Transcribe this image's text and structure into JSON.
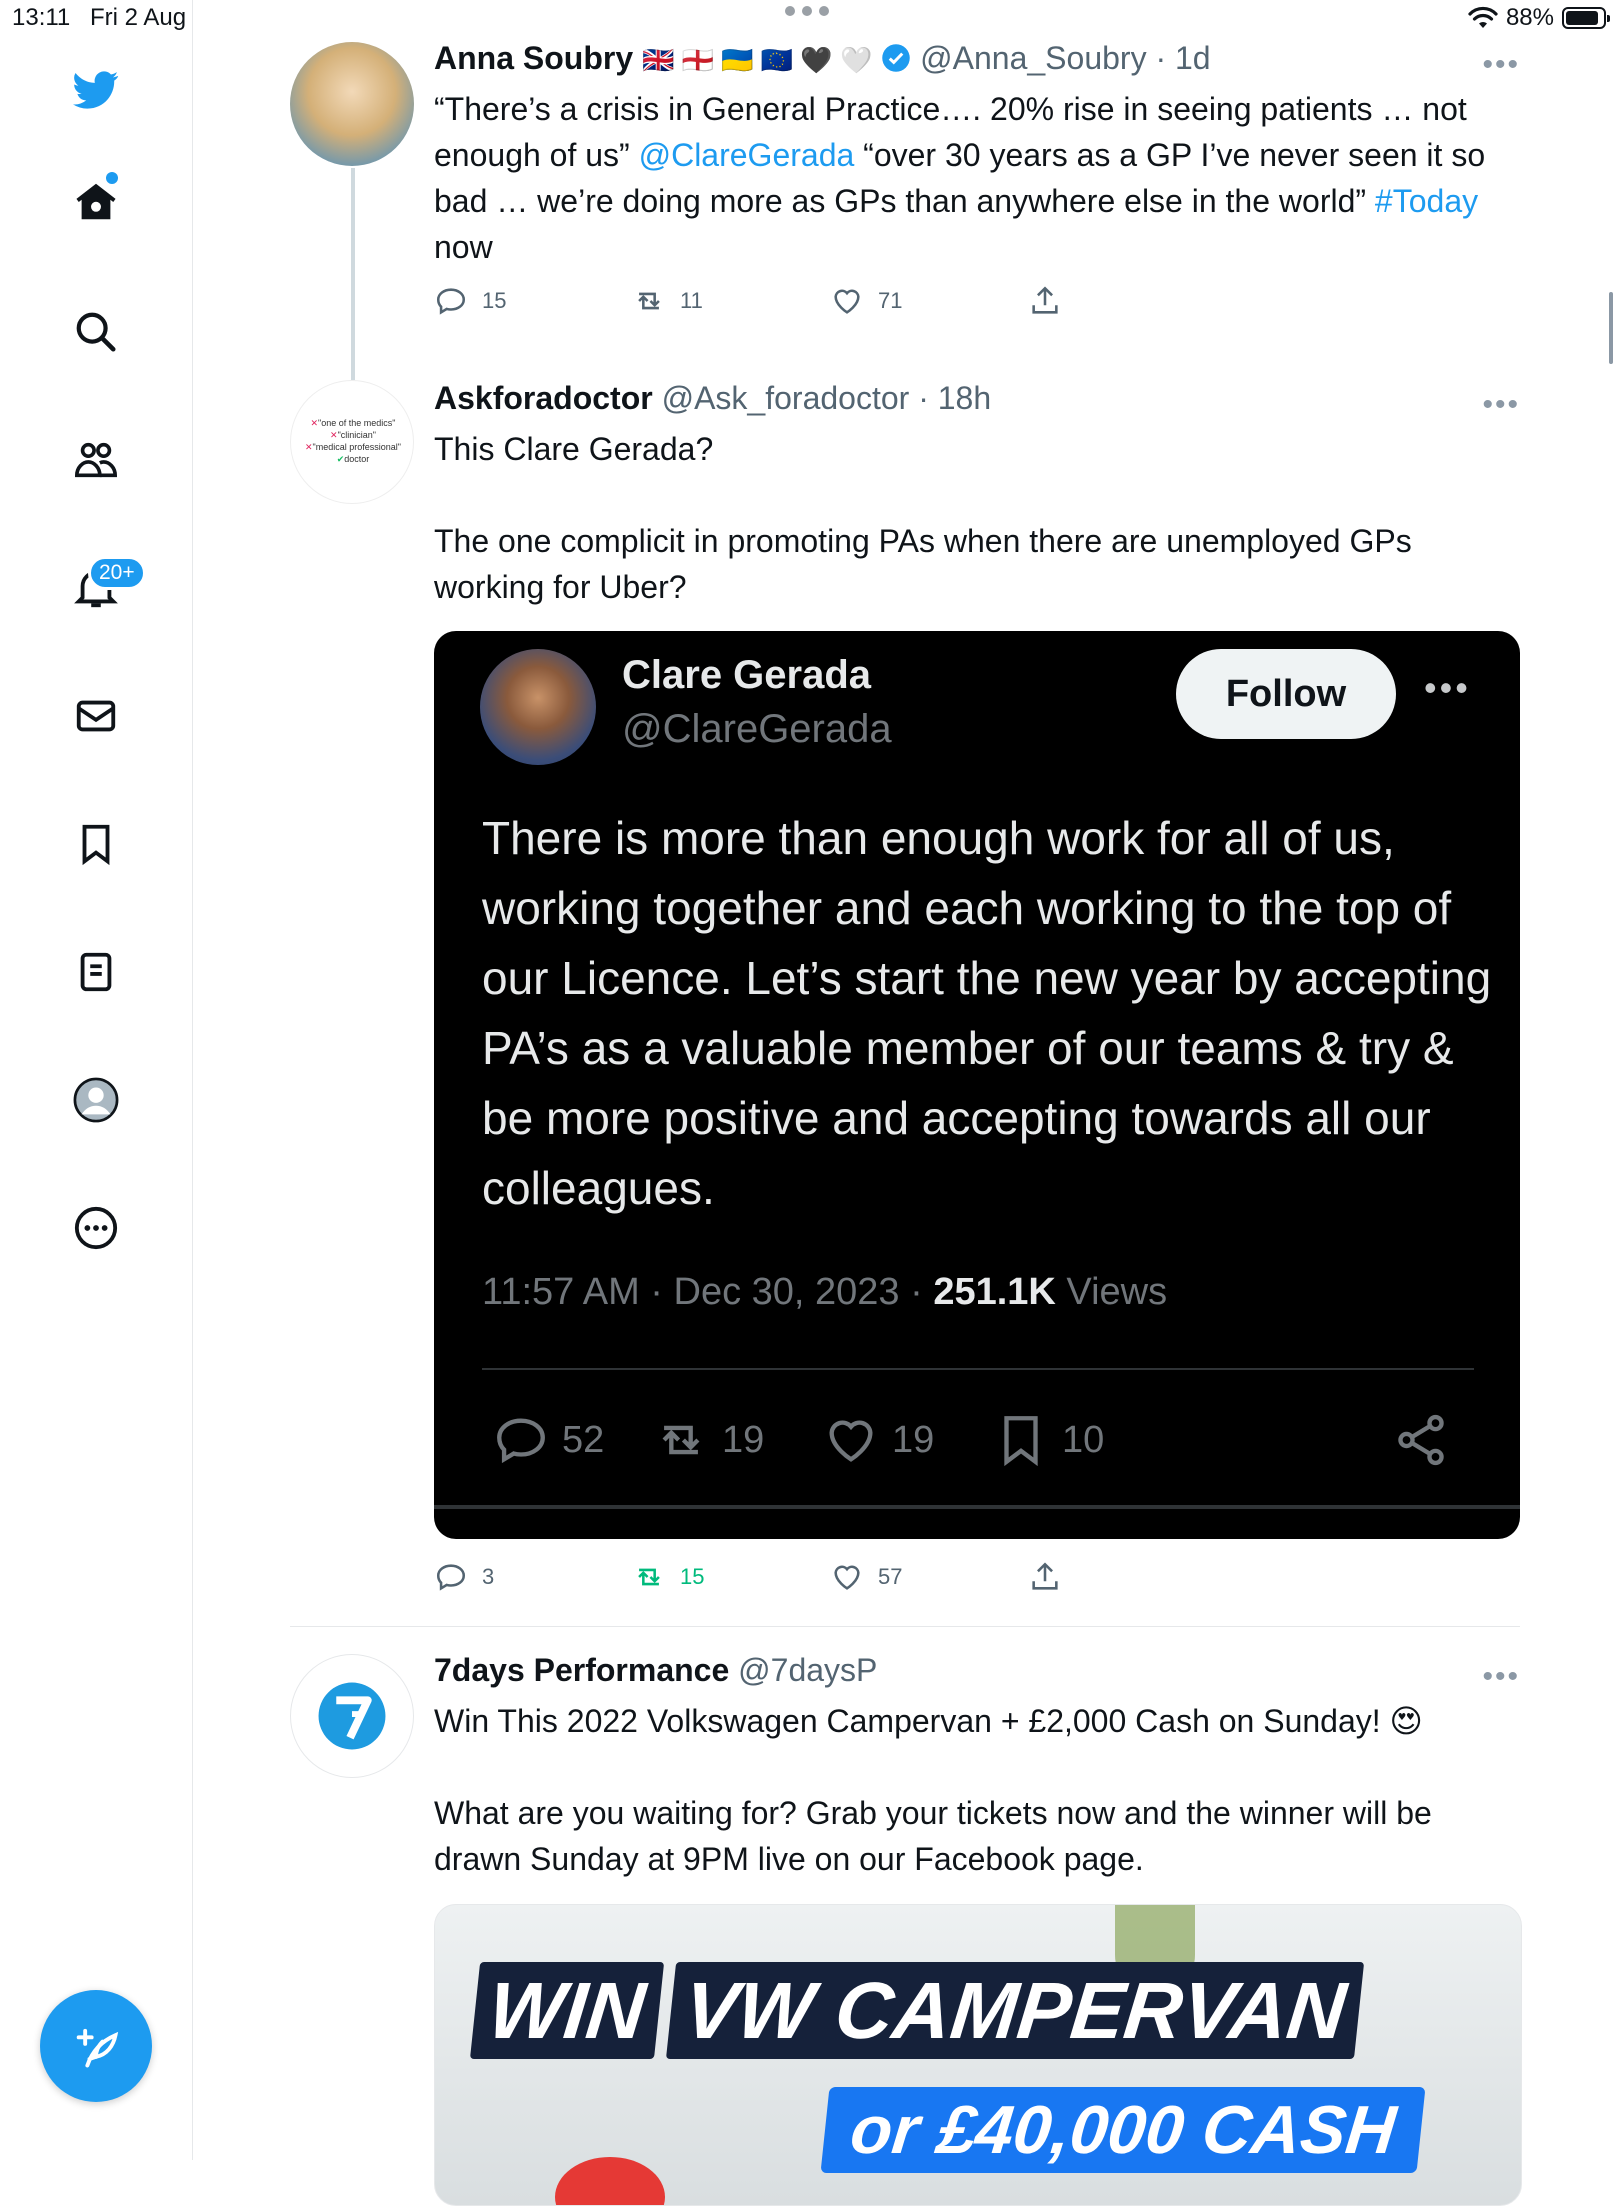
{
  "status_bar": {
    "time": "13:11",
    "date": "Fri 2 Aug",
    "battery": "88%",
    "battery_level": 0.88
  },
  "sidebar": {
    "notifications_badge": "20+",
    "items": [
      "home",
      "explore",
      "communities",
      "notifications",
      "messages",
      "bookmarks",
      "lists",
      "profile",
      "more"
    ]
  },
  "tweets": [
    {
      "name": "Anna Soubry",
      "flags": "🇬🇧 🏴󠁧󠁢󠁥󠁮󠁧󠁿 🇺🇦 🇪🇺 🖤 🤍",
      "handle": "@Anna_Soubry",
      "time": "· 1d",
      "text_1": "“There’s a crisis in General Practice…. 20% rise in seeing patients … not enough of us” ",
      "mention": "@ClareGerada",
      "text_2": " “over 30 years as a GP I’ve never seen it so bad … we’re doing more as GPs than anywhere else in the world” ",
      "hashtag": "#Today",
      "text_3": " now",
      "replies": "15",
      "retweets": "11",
      "likes": "71"
    },
    {
      "name": "Askforadoctor",
      "handle": "@Ask_foradoctor",
      "time": "· 18h",
      "avatar_lines": [
        "\"one of the medics\"",
        "\"clinician\"",
        "\"medical professional\"",
        "doctor"
      ],
      "text_p1": "This Clare Gerada?",
      "text_p2": "The one complicit in promoting PAs when there are unemployed GPs working for Uber?",
      "replies": "3",
      "retweets": "15",
      "likes": "57",
      "embed": {
        "name": "Clare Gerada",
        "handle": "@ClareGerada",
        "follow_label": "Follow",
        "text": "There is more than enough work for all of us, working together and each working to the top of our Licence. Let’s start the new year by accepting PA’s as a valuable member of our teams & try & be more positive and accepting towards all our colleagues.",
        "time": "11:57 AM · Dec 30, 2023 · ",
        "views_count": "251.1K",
        "views_label": " Views",
        "replies": "52",
        "retweets": "19",
        "likes": "19",
        "bookmarks": "10"
      }
    },
    {
      "name": "7days Performance",
      "handle": "@7daysP",
      "text_p1": "Win This 2022 Volkswagen Campervan + £2,000 Cash on Sunday! 😍",
      "text_p2": "What are you waiting for? Grab your tickets now and the winner will be drawn Sunday at 9PM live on our Facebook page.",
      "promo_line1_a": "WIN",
      "promo_line1_b": "VW CAMPERVAN",
      "promo_line2": "or £40,000 CASH"
    }
  ],
  "colors": {
    "accent": "#1d9bf0",
    "retweet_active": "#00ba7c",
    "text": "#0f1419",
    "muted": "#536471"
  }
}
